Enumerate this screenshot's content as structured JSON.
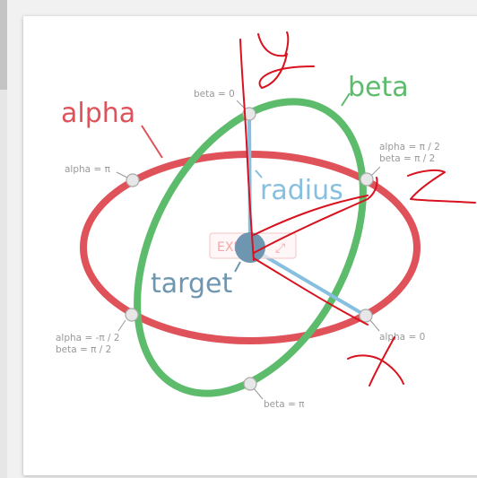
{
  "labels": {
    "alpha": "alpha",
    "beta": "beta",
    "radius": "radius",
    "target": "target",
    "beta_0": "beta = 0",
    "beta_pi": "beta = π",
    "alpha_pi": "alpha = π",
    "alpha_0": "alpha = 0",
    "alpha_pi2": "alpha = π / 2",
    "beta_pi2": "beta = π / 2",
    "alpha_neg_pi2": "alpha = -π / 2",
    "beta_pi2_b": "beta = π / 2"
  },
  "overlay": {
    "exit_label": "EXIT",
    "expand_glyph": "⤢"
  },
  "colors": {
    "alpha": "#e0525a",
    "beta": "#5dbb6c",
    "radius": "#86bfe0",
    "target": "#6f96b0",
    "annotation": "#d8121e",
    "handle_fill": "#e7e7e7",
    "handle_stroke": "#aaaaaa"
  },
  "handwritten": {
    "y": "y",
    "z": "z",
    "x": "x"
  }
}
